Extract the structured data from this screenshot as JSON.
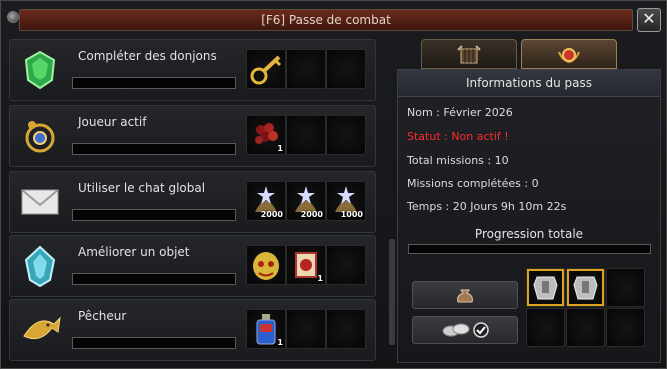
{
  "window": {
    "title": "[F6] Passe de combat",
    "close_label": "✕"
  },
  "missions": [
    {
      "label": "Compléter des donjons",
      "icon": "green-gem-icon",
      "progress": 0,
      "rewards": [
        {
          "icon": "gold-key-icon",
          "count": ""
        },
        {
          "icon": "",
          "count": ""
        },
        {
          "icon": "",
          "count": ""
        }
      ]
    },
    {
      "label": "Joueur actif",
      "icon": "gold-amulet-icon",
      "progress": 0,
      "rewards": [
        {
          "icon": "red-berries-icon",
          "count": "1"
        },
        {
          "icon": "",
          "count": ""
        },
        {
          "icon": "",
          "count": ""
        }
      ]
    },
    {
      "label": "Utiliser le chat global",
      "icon": "envelope-icon",
      "progress": 0,
      "rewards": [
        {
          "icon": "star-pouch-icon",
          "count": "2000"
        },
        {
          "icon": "star-pouch-icon",
          "count": "2000"
        },
        {
          "icon": "star-pouch-icon",
          "count": "1000"
        }
      ]
    },
    {
      "label": "Améliorer un objet",
      "icon": "blue-crystal-icon",
      "progress": 0,
      "rewards": [
        {
          "icon": "golden-mask-icon",
          "count": ""
        },
        {
          "icon": "red-scroll-icon",
          "count": "1"
        },
        {
          "icon": "",
          "count": ""
        }
      ]
    },
    {
      "label": "Pêcheur",
      "icon": "golden-fish-icon",
      "progress": 0,
      "rewards": [
        {
          "icon": "potion-bottle-icon",
          "count": "1"
        },
        {
          "icon": "",
          "count": ""
        },
        {
          "icon": "",
          "count": ""
        }
      ]
    }
  ],
  "tabs": [
    {
      "name": "gate-tab",
      "icon": "dungeon-gate-icon",
      "active": false
    },
    {
      "name": "medal-tab",
      "icon": "medal-icon",
      "active": true
    }
  ],
  "info": {
    "header": "Informations du pass",
    "name_line": "Nom : Février 2026",
    "status_line": "Statut : Non actif !",
    "total_line": "Total missions : 10",
    "completed_line": "Missions complétées : 0",
    "time_line": "Temps : 20 Jours  9h 10m 22s",
    "progress_label": "Progression totale",
    "progress": 0
  },
  "buttons": [
    {
      "name": "money-bag-button",
      "icon": "money-bag-icon"
    },
    {
      "name": "coins-confirm-button",
      "icon": "coins-check-icon"
    }
  ],
  "final_rewards": [
    {
      "icon": "armor-set-icon"
    },
    {
      "icon": "armor-set-icon"
    },
    {
      "icon": ""
    },
    {
      "icon": ""
    },
    {
      "icon": ""
    },
    {
      "icon": ""
    }
  ],
  "colors": {
    "status": "#ff2a2a",
    "title_bar": "#5a2216",
    "frame": "#9b8055"
  }
}
